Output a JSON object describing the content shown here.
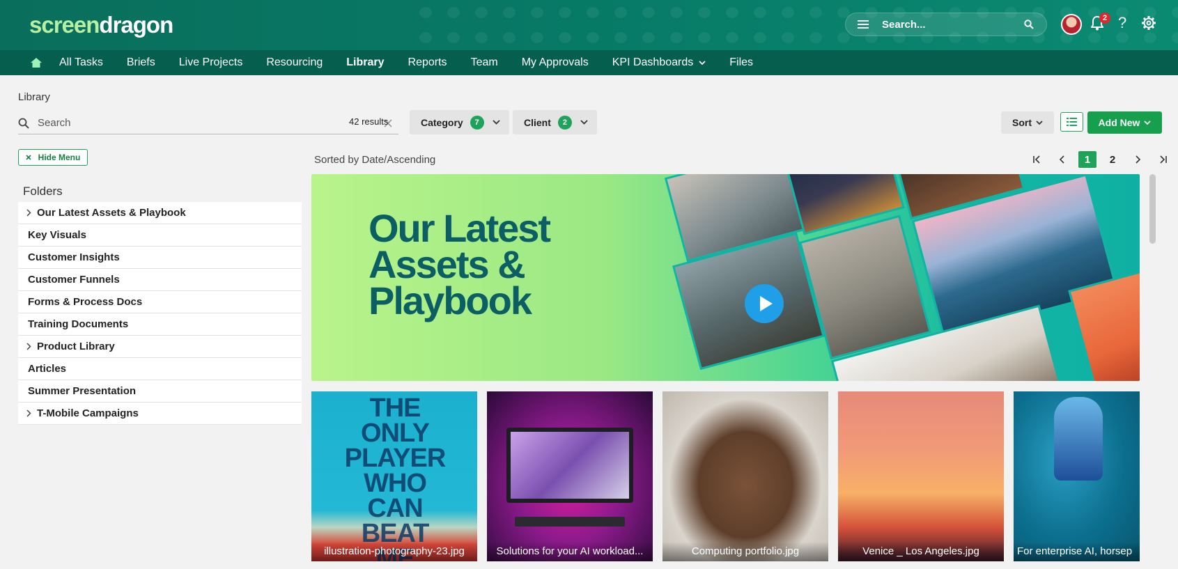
{
  "header": {
    "logo_part1": "screen",
    "logo_part2": "dragon",
    "search_placeholder": "Search...",
    "notification_count": "2",
    "help_label": "?"
  },
  "nav": {
    "items": [
      {
        "label": "All Tasks"
      },
      {
        "label": "Briefs"
      },
      {
        "label": "Live Projects"
      },
      {
        "label": "Resourcing"
      },
      {
        "label": "Library",
        "active": true
      },
      {
        "label": "Reports"
      },
      {
        "label": "Team"
      },
      {
        "label": "My Approvals"
      },
      {
        "label": "KPI Dashboards"
      },
      {
        "label": "Files"
      }
    ]
  },
  "page": {
    "breadcrumb": "Library",
    "search_placeholder": "Search",
    "results_text": "42 results",
    "filters": [
      {
        "label": "Category",
        "count": "7"
      },
      {
        "label": "Client",
        "count": "2"
      }
    ],
    "sort_label": "Sort",
    "add_new_label": "Add New",
    "hide_menu_label": "Hide Menu",
    "sorted_by": "Sorted by Date/Ascending",
    "pagination": {
      "current": "1",
      "next": "2"
    }
  },
  "folders": {
    "title": "Folders",
    "items": [
      {
        "label": "Our Latest Assets & Playbook",
        "expandable": true
      },
      {
        "label": "Key Visuals",
        "expandable": false
      },
      {
        "label": "Customer Insights",
        "expandable": false
      },
      {
        "label": "Customer Funnels",
        "expandable": false
      },
      {
        "label": "Forms & Process Docs",
        "expandable": false
      },
      {
        "label": "Training Documents",
        "expandable": false
      },
      {
        "label": "Product Library",
        "expandable": true
      },
      {
        "label": "Articles",
        "expandable": false
      },
      {
        "label": "Summer Presentation",
        "expandable": false
      },
      {
        "label": "T-Mobile Campaigns",
        "expandable": true
      }
    ]
  },
  "banner": {
    "title": "Our Latest Assets & Playbook"
  },
  "assets": [
    {
      "name": "illustration-photography-23.jpg",
      "poster_text": "THE ONLY PLAYER WHO CAN BEAT ME"
    },
    {
      "name": "Solutions for your AI workload..."
    },
    {
      "name": "Computing portfolio.jpg"
    },
    {
      "name": "Venice _ Los Angeles.jpg"
    },
    {
      "name": "For enterprise AI, horsep"
    }
  ],
  "colors": {
    "header_bg": "#0a6e5c",
    "nav_bg": "#055e4e",
    "accent_green": "#1fa25a",
    "banner_text": "#0b5e63"
  }
}
